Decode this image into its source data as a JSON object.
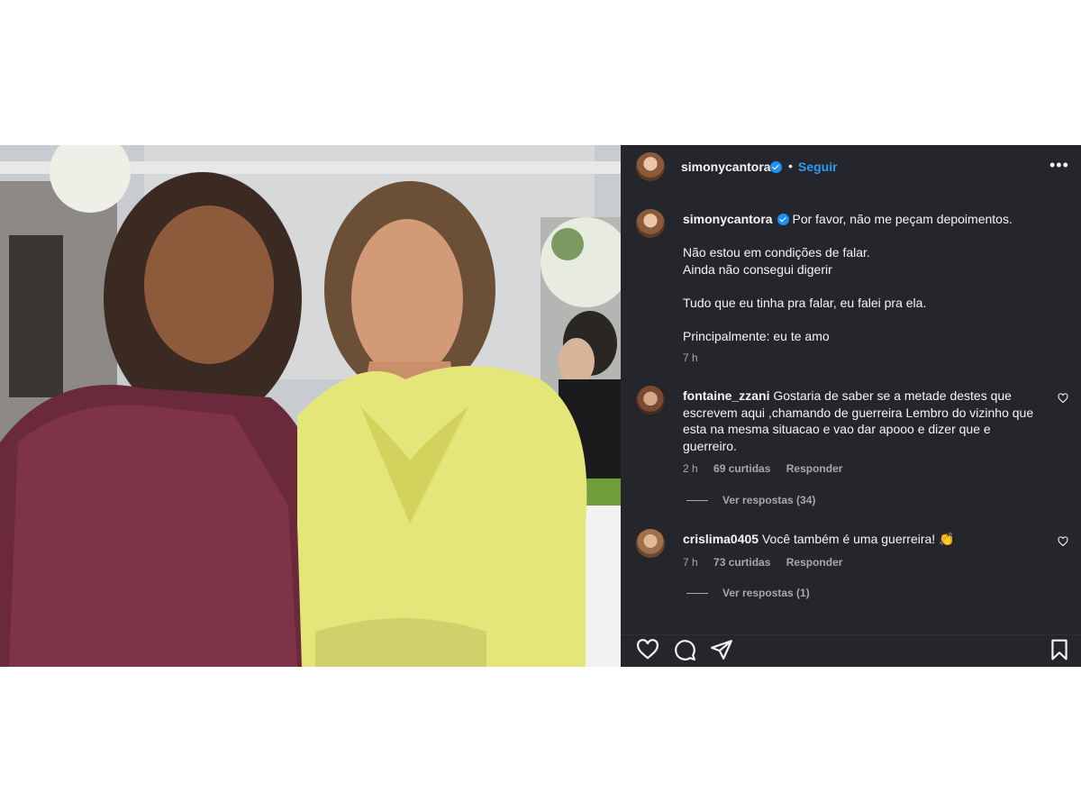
{
  "post": {
    "username": "simonycantora",
    "separator": "•",
    "follow_label": "Seguir",
    "more_label": "•••",
    "caption": {
      "lines": [
        "Por favor, não me peçam depoimentos.",
        "Não estou em condições de falar.",
        "Ainda não consegui digerir",
        "Tudo que eu tinha pra falar, eu falei pra ela.",
        "Principalmente: eu te amo"
      ],
      "time": "7 h"
    },
    "comments": [
      {
        "username": "fontaine_zzani",
        "text": "Gostaria de saber se a metade destes que escrevem aqui ,chamando de guerreira Lembro do vizinho que esta na mesma situacao e vao dar apooo e dizer que e guerreiro.",
        "time": "2 h",
        "likes": "69 curtidas",
        "reply_label": "Responder",
        "view_replies": "Ver respostas (34)"
      },
      {
        "username": "crislima0405",
        "text": "Você também é uma guerreira! 👏",
        "time": "7 h",
        "likes": "73 curtidas",
        "reply_label": "Responder",
        "view_replies": "Ver respostas (1)"
      }
    ],
    "icons": {
      "like": "heart-icon",
      "comment": "comment-icon",
      "share": "share-icon",
      "save": "bookmark-icon",
      "more": "more-icon"
    },
    "colors": {
      "panel_bg": "#25262b",
      "link_blue": "#2a9af3",
      "verified_blue": "#1f8ff0",
      "muted": "#a8a8a8"
    }
  }
}
